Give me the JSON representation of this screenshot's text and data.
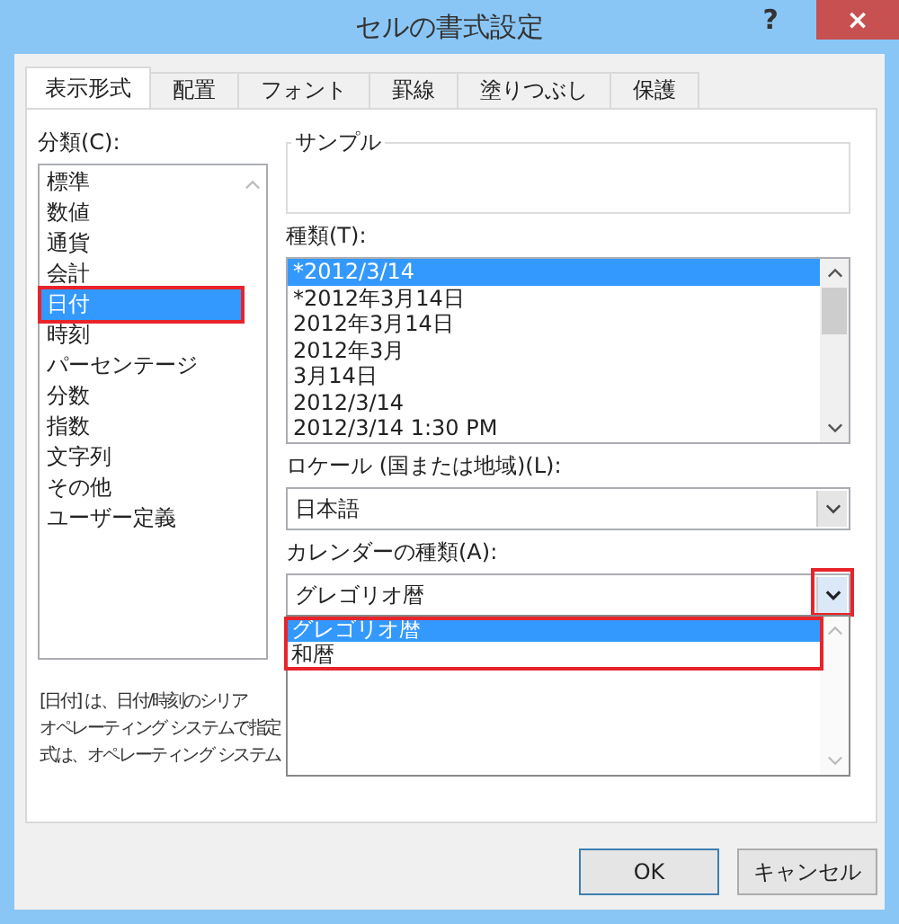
{
  "window": {
    "title": "セルの書式設定",
    "help": "?",
    "close": "×"
  },
  "tabs": [
    {
      "label": "表示形式",
      "selected": true
    },
    {
      "label": "配置",
      "selected": false
    },
    {
      "label": "フォント",
      "selected": false
    },
    {
      "label": "罫線",
      "selected": false
    },
    {
      "label": "塗りつぶし",
      "selected": false
    },
    {
      "label": "保護",
      "selected": false
    }
  ],
  "category": {
    "label": "分類(C):",
    "items": [
      {
        "label": "標準",
        "selected": false
      },
      {
        "label": "数値",
        "selected": false
      },
      {
        "label": "通貨",
        "selected": false
      },
      {
        "label": "会計",
        "selected": false
      },
      {
        "label": "日付",
        "selected": true
      },
      {
        "label": "時刻",
        "selected": false
      },
      {
        "label": "パーセンテージ",
        "selected": false
      },
      {
        "label": "分数",
        "selected": false
      },
      {
        "label": "指数",
        "selected": false
      },
      {
        "label": "文字列",
        "selected": false
      },
      {
        "label": "その他",
        "selected": false
      },
      {
        "label": "ユーザー定義",
        "selected": false
      }
    ]
  },
  "sample": {
    "label": "サンプル"
  },
  "type": {
    "label": "種類(T):",
    "items": [
      {
        "label": "*2012/3/14",
        "selected": true
      },
      {
        "label": "*2012年3月14日",
        "selected": false
      },
      {
        "label": "2012年3月14日",
        "selected": false
      },
      {
        "label": "2012年3月",
        "selected": false
      },
      {
        "label": "3月14日",
        "selected": false
      },
      {
        "label": "2012/3/14",
        "selected": false
      },
      {
        "label": "2012/3/14 1:30 PM",
        "selected": false
      }
    ]
  },
  "locale": {
    "label": "ロケール (国または地域)(L):",
    "value": "日本語"
  },
  "calendar": {
    "label": "カレンダーの種類(A):",
    "value": "グレゴリオ暦",
    "expanded": true,
    "options": [
      {
        "label": "グレゴリオ暦",
        "selected": true
      },
      {
        "label": "和暦",
        "selected": false
      }
    ]
  },
  "description": [
    "[日付] は、日付/時刻のシリア",
    "オペレーティング システムで指定",
    "式は、オペレーティング システム"
  ],
  "buttons": [
    {
      "label": "OK",
      "kind": "default"
    },
    {
      "label": "キャンセル",
      "kind": "normal"
    }
  ]
}
